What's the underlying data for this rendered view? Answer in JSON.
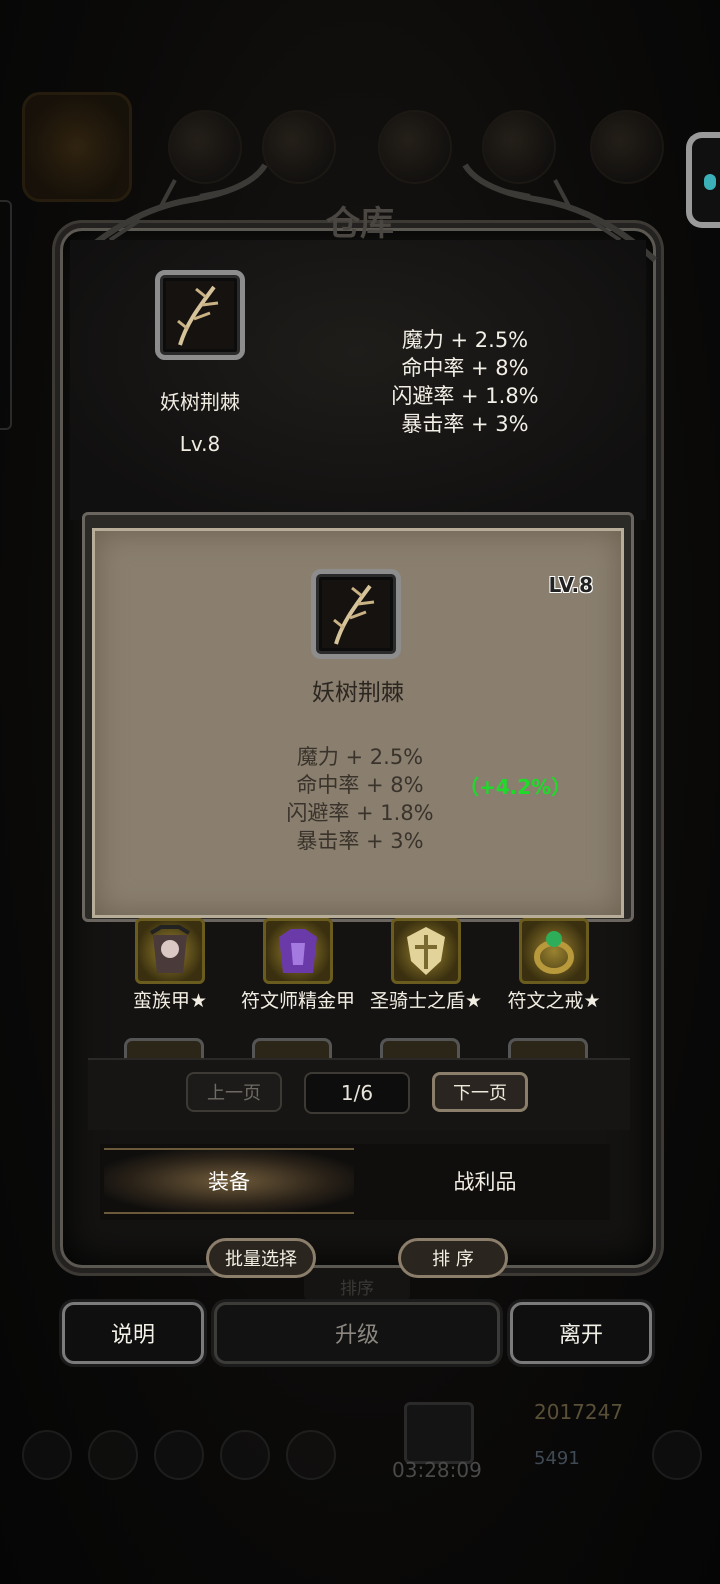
{
  "screen": {
    "title": "仓库"
  },
  "selected_item": {
    "name": "妖树荆棘",
    "level": "Lv.8",
    "stats": [
      "魔力 + 2.5%",
      "命中率 + 8%",
      "闪避率 + 1.8%",
      "暴击率 + 3%"
    ],
    "icon": "thorn-branch-icon"
  },
  "detail_card": {
    "level": "LV.8",
    "name": "妖树荆棘",
    "stats": [
      "魔力 + 2.5%",
      "命中率 + 8%",
      "闪避率 + 1.8%",
      "暴击率 + 3%"
    ],
    "bonus": "（+4.2%）",
    "bonus_color": "#1edb2a"
  },
  "inventory": {
    "items": [
      {
        "label": "蛮族甲★",
        "icon": "barbarian-armor-icon"
      },
      {
        "label": "符文师精金甲",
        "icon": "runemaster-armor-icon"
      },
      {
        "label": "圣骑士之盾★",
        "icon": "paladin-shield-icon"
      },
      {
        "label": "符文之戒★",
        "icon": "rune-ring-icon"
      }
    ]
  },
  "pager": {
    "prev_label": "上一页",
    "page": "1/6",
    "next_label": "下一页"
  },
  "tabs": [
    {
      "label": "装备",
      "active": true
    },
    {
      "label": "战利品",
      "active": false
    }
  ],
  "actions": {
    "batch_select": "批量选择",
    "sort": "排 序",
    "sort_ghost": "排序"
  },
  "bottom_buttons": {
    "help": "说明",
    "upgrade": "升级",
    "leave": "离开"
  },
  "footer": {
    "gold": "2017247",
    "gems": "5491",
    "timer": "03:28:09"
  }
}
